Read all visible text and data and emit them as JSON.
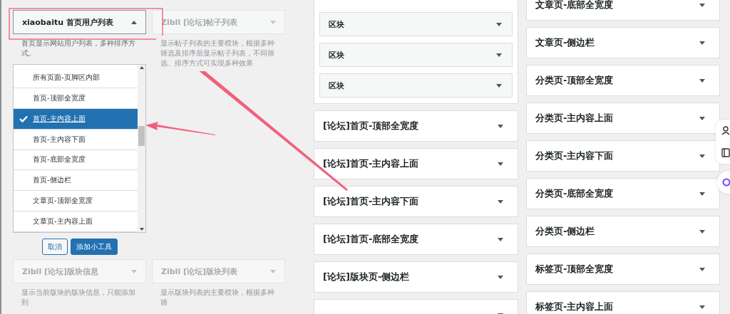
{
  "picker": {
    "title": "xiaobaitu 首页用户列表",
    "expanded": true,
    "description": "首页显示网站用户列表，多种排序方式。",
    "areas": [
      {
        "label": "所有页面-页脚区内部",
        "selected": false
      },
      {
        "label": "首页-顶部全宽度",
        "selected": false
      },
      {
        "label": "首页-主内容上面",
        "selected": true
      },
      {
        "label": "首页-主内容下面",
        "selected": false
      },
      {
        "label": "首页-底部全宽度",
        "selected": false
      },
      {
        "label": "首页-侧边栏",
        "selected": false
      },
      {
        "label": "文章页-顶部全宽度",
        "selected": false
      },
      {
        "label": "文章页-主内容上面",
        "selected": false
      }
    ],
    "buttons": [
      {
        "label": "取消",
        "kind": "secondary"
      },
      {
        "label": "添加小工具",
        "kind": "primary"
      }
    ]
  },
  "side_widget": {
    "title": "Zibll [论坛]帖子列表",
    "description": "显示帖子列表的主要模块，根据多种筛选及排序后显示帖子列表，不同筛选、排序方式可实现多种效果"
  },
  "lower_widgets": [
    {
      "title": "Zibll [论坛]版块信息",
      "description": "显示当前版块的版块信息，只能添加到"
    },
    {
      "title": "Zibll [论坛]版块列表",
      "description": "显示版块列表的主要模块，根据多种筛"
    }
  ],
  "open_area": {
    "blocks": [
      "区块",
      "区块",
      "区块"
    ]
  },
  "middle_areas": [
    "[论坛]首页-顶部全宽度",
    "[论坛]首页-主内容上面",
    "[论坛]首页-主内容下面",
    "[论坛]首页-底部全宽度",
    "[论坛]版块页-侧边栏"
  ],
  "right_areas": [
    "文章页-底部全宽度",
    "文章页-侧边栏",
    "分类页-顶部全宽度",
    "分类页-主内容上面",
    "分类页-主内容下面",
    "分类页-底部全宽度",
    "分类页-侧边栏",
    "标签页-顶部全宽度",
    "标签页-主内容上面"
  ]
}
